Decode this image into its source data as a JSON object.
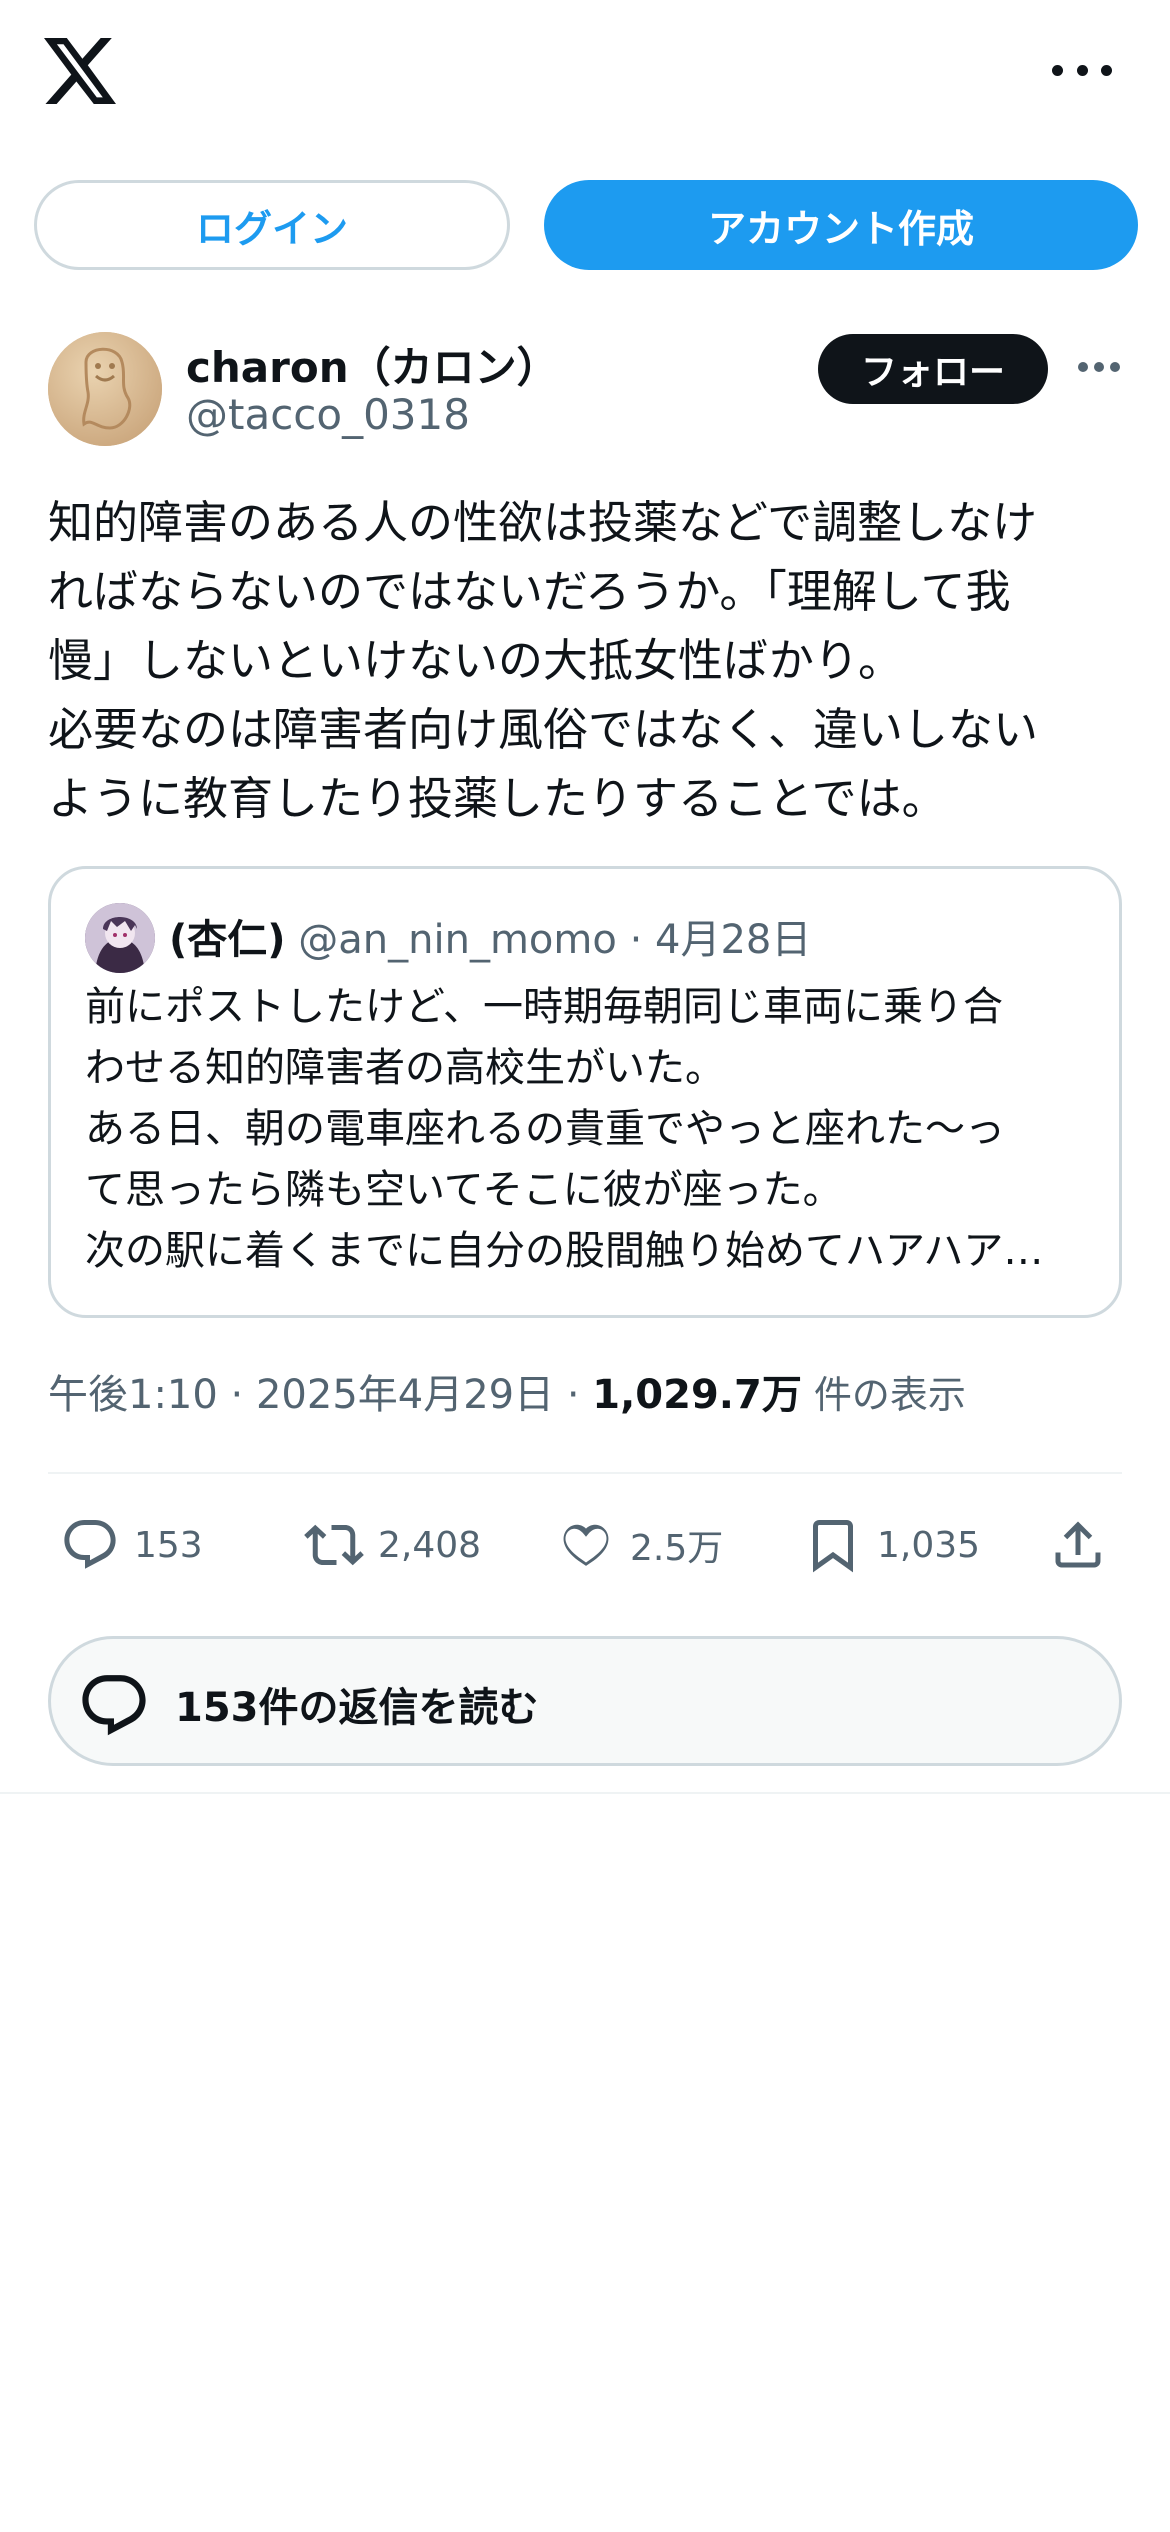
{
  "topbar": {
    "logo_icon": "x-logo-icon",
    "menu_icon": "more-horizontal-icon"
  },
  "auth": {
    "login_label": "ログイン",
    "signup_label": "アカウント作成"
  },
  "post": {
    "display_name": "charon（カロン）",
    "handle": "@tacco_0318",
    "follow_label": "フォロー",
    "text_lines": [
      "知的障害のある人の性欲は投薬などで調整しなけ",
      "ればならないのではないだろうか。「理解して我",
      "慢」しないといけないの大抵女性ばかり。",
      "必要なのは障害者向け風俗ではなく、違いしない",
      "ように教育したり投薬したりすることでは。"
    ],
    "timestamp": "午後1:10 · 2025年4月29日 · ",
    "views_count": "1,029.7万",
    "views_label": " 件の表示"
  },
  "quote": {
    "display_name": "(杏仁)",
    "handle": "@an_nin_momo",
    "separator": "·",
    "date": "4月28日",
    "text_lines": [
      "前にポストしたけど、一時期毎朝同じ車両に乗り合",
      "わせる知的障害者の高校生がいた。",
      "ある日、朝の電車座れるの貴重でやっと座れた〜っ",
      "て思ったら隣も空いてそこに彼が座った。",
      "次の駅に着くまでに自分の股間触り始めてハアハア…"
    ]
  },
  "actions": {
    "replies": "153",
    "reposts": "2,408",
    "likes": "2.5万",
    "bookmarks": "1,035"
  },
  "read_replies": {
    "label": "153件の返信を読む"
  },
  "colors": {
    "accent": "#1d9bf0",
    "text_primary": "#0f1419",
    "text_secondary": "#536471",
    "border": "#cfd9de"
  }
}
